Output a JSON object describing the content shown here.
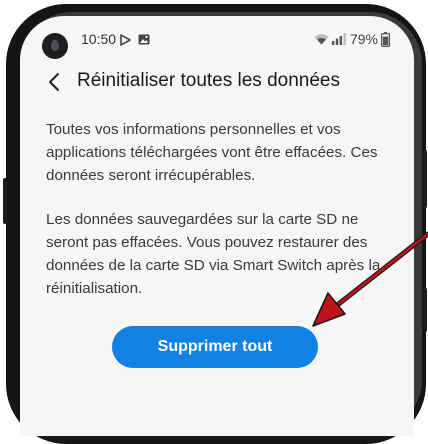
{
  "status_bar": {
    "time": "10:50",
    "battery_percent": "79%",
    "icons": [
      "play-icon",
      "image-icon",
      "wifi-icon",
      "signal-icon",
      "battery-icon"
    ]
  },
  "header": {
    "back_icon": "chevron-left-icon",
    "title": "Réinitialiser toutes les données"
  },
  "content": {
    "paragraph_1": "Toutes vos informations personnelles et vos applications téléchargées vont être effacées. Ces données seront irrécupérables.",
    "paragraph_2": "Les données sauvegardées sur la carte SD ne seront pas effacées. Vous pouvez restaurer des données de la carte SD via Smart Switch après la réinitialisation."
  },
  "action": {
    "delete_all_label": "Supprimer tout"
  },
  "colors": {
    "accent": "#1281e4",
    "annotation_arrow": "#c0121a",
    "background": "#f6f6f6"
  }
}
